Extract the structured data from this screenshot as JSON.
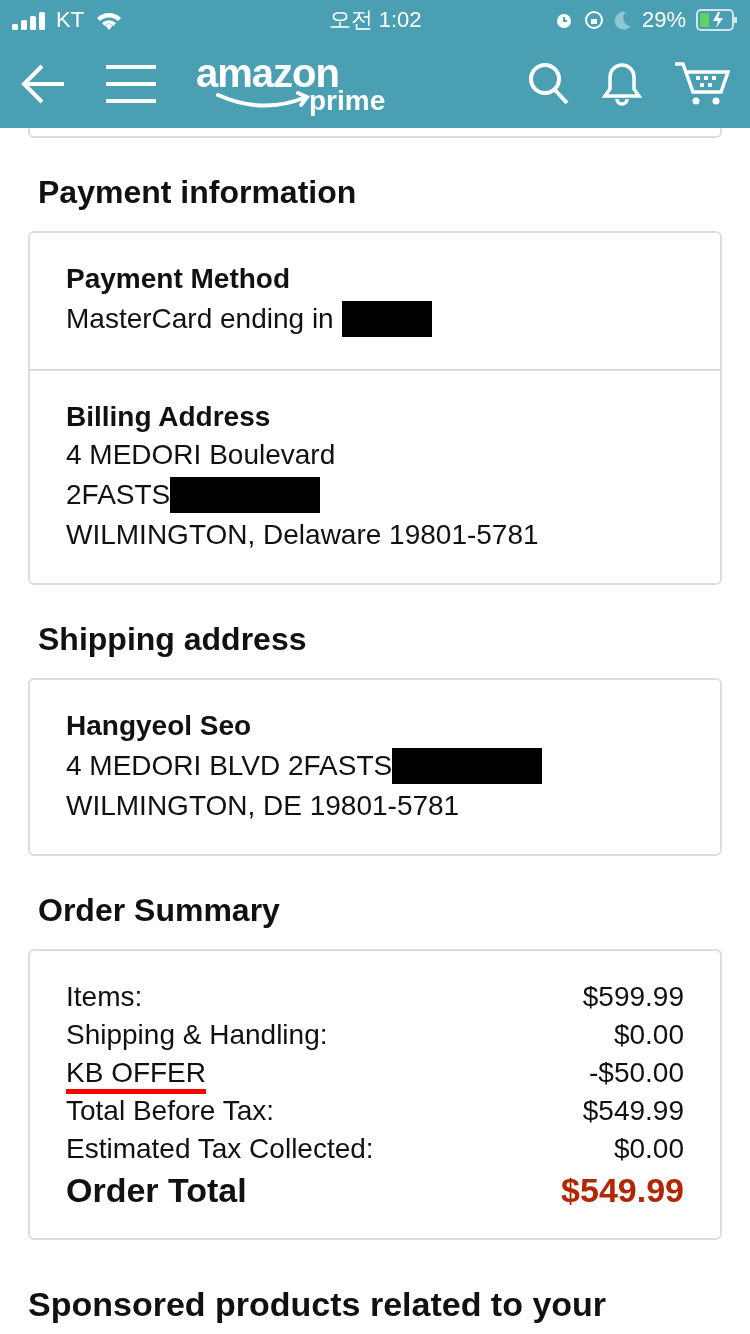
{
  "status_bar": {
    "carrier": "KT",
    "time": "오전 1:02",
    "battery": "29%"
  },
  "header": {
    "logo_word": "amazon",
    "logo_sub": "prime"
  },
  "payment": {
    "title": "Payment information",
    "sections": [
      {
        "heading": "Payment Method",
        "lines": [
          {
            "text": "MasterCard ending in",
            "redacted": true
          }
        ]
      },
      {
        "heading": "Billing Address",
        "lines": [
          {
            "text": "4 MEDORI Boulevard",
            "redacted": false
          },
          {
            "text": "2FASTS",
            "redacted": true
          },
          {
            "text": "WILMINGTON, Delaware 19801-5781",
            "redacted": false
          }
        ]
      }
    ]
  },
  "shipping": {
    "title": "Shipping address",
    "name": "Hangyeol Seo",
    "lines": [
      {
        "text": "4 MEDORI BLVD 2FASTS",
        "redacted": true
      },
      {
        "text": "WILMINGTON, DE 19801-5781",
        "redacted": false
      }
    ]
  },
  "summary": {
    "title": "Order Summary",
    "rows": [
      {
        "label": "Items:",
        "value": "$599.99",
        "underlined": false
      },
      {
        "label": "Shipping & Handling:",
        "value": "$0.00",
        "underlined": false
      },
      {
        "label": "KB OFFER",
        "value": "-$50.00",
        "underlined": true
      },
      {
        "label": "Total Before Tax:",
        "value": "$549.99",
        "underlined": false
      },
      {
        "label": "Estimated Tax Collected:",
        "value": "$0.00",
        "underlined": false
      }
    ],
    "total_label": "Order Total",
    "total_value": "$549.99"
  },
  "sponsored": {
    "title": "Sponsored products related to your"
  }
}
